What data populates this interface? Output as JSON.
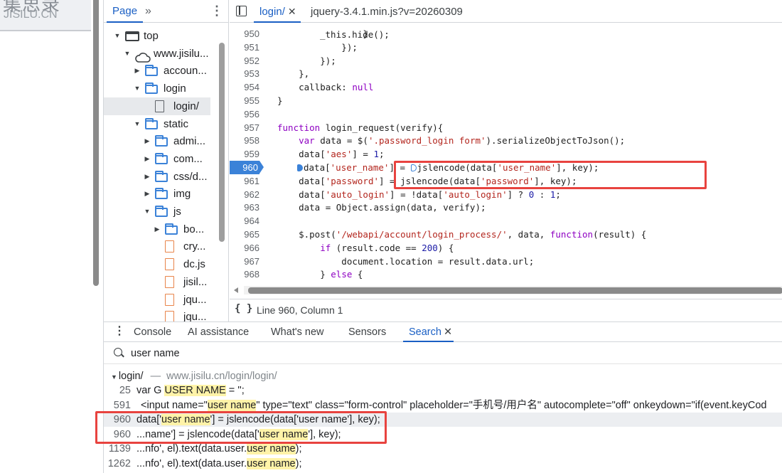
{
  "site": {
    "logo_cn": "集思录",
    "logo_en": "JISILU.CN"
  },
  "navigator": {
    "tab_label": "Page",
    "more_label": "»",
    "menu_label": "⋮",
    "items": [
      {
        "label": "top",
        "icon": "window-icon",
        "expand": "▼"
      },
      {
        "label": "www.jisilu...",
        "icon": "cloud-icon",
        "expand": "▼"
      },
      {
        "label": "accoun...",
        "icon": "folder-icon",
        "expand": "▶"
      },
      {
        "label": "login",
        "icon": "folder-icon",
        "expand": "▼"
      },
      {
        "label": "login/",
        "icon": "file-icon",
        "expand": ""
      },
      {
        "label": "static",
        "icon": "folder-icon",
        "expand": "▼"
      },
      {
        "label": "admi...",
        "icon": "folder-icon",
        "expand": "▶"
      },
      {
        "label": "com...",
        "icon": "folder-icon",
        "expand": "▶"
      },
      {
        "label": "css/d...",
        "icon": "folder-icon",
        "expand": "▶"
      },
      {
        "label": "img",
        "icon": "folder-icon",
        "expand": "▶"
      },
      {
        "label": "js",
        "icon": "folder-icon",
        "expand": "▼"
      },
      {
        "label": "bo...",
        "icon": "folder-icon",
        "expand": "▶"
      },
      {
        "label": "cry...",
        "icon": "js-file-icon",
        "expand": ""
      },
      {
        "label": "dc.js",
        "icon": "js-file-icon",
        "expand": ""
      },
      {
        "label": "jisil...",
        "icon": "js-file-icon",
        "expand": ""
      },
      {
        "label": "jqu...",
        "icon": "js-file-icon",
        "expand": ""
      },
      {
        "label": "jqu...",
        "icon": "js-file-icon",
        "expand": ""
      }
    ]
  },
  "editor": {
    "tabs": [
      {
        "label": "login/",
        "close": "✕"
      },
      {
        "label": "jquery-3.4.1.min.js?v=20260309"
      }
    ],
    "lines": [
      {
        "n": "950",
        "code": "                }"
      },
      {
        "n": "951",
        "code": "            });"
      },
      {
        "n": "952",
        "code": "        });"
      },
      {
        "n": "953",
        "code": "    },"
      },
      {
        "n": "954",
        "code": "    callback: null"
      },
      {
        "n": "955",
        "code": "}"
      },
      {
        "n": "956",
        "code": ""
      },
      {
        "n": "957",
        "code": "function login_request(verify){"
      },
      {
        "n": "958",
        "code": "    var data = $('.password_login form').serializeObjectToJson();"
      },
      {
        "n": "959",
        "code": "    data['aes'] = 1;"
      },
      {
        "n": "960",
        "code": "data['user_name'] = jslencode(data['user_name'], key);"
      },
      {
        "n": "961",
        "code": "    data['password'] = jslencode(data['password'], key);"
      },
      {
        "n": "962",
        "code": "    data['auto_login'] = !data['auto_login'] ? 0 : 1;"
      },
      {
        "n": "963",
        "code": "    data = Object.assign(data, verify);"
      },
      {
        "n": "964",
        "code": ""
      },
      {
        "n": "965",
        "code": "    $.post('/webapi/account/login_process/', data, function(result) {"
      },
      {
        "n": "966",
        "code": "        if (result.code == 200) {"
      },
      {
        "n": "967",
        "code": "            document.location = result.data.url;"
      },
      {
        "n": "968",
        "code": "        } else {"
      }
    ],
    "partial_top_line": "_this.hide();",
    "pretty_print_label": "{ }",
    "cursor_position": "Line 960, Column 1"
  },
  "drawer": {
    "menu_label": "⋮",
    "tabs": [
      "Console",
      "AI assistance",
      "What's new",
      "Sensors",
      "Search"
    ],
    "active_tab_close": "✕",
    "search_value": "user name",
    "result_file": {
      "name": "login/",
      "separator": "—",
      "path": "www.jisilu.cn/login/login/"
    },
    "results": [
      {
        "n": "25",
        "pre": "var G ",
        "match": "USER NAME",
        "post": " = '';"
      },
      {
        "n": "591",
        "pre": "<input name=\"",
        "match": "user name",
        "post": "\" type=\"text\" class=\"form-control\" placeholder=\"手机号/用户名\" autocomplete=\"off\" onkeydown=\"if(event.keyCod"
      },
      {
        "n": "960",
        "pre": "data['",
        "match": "user name",
        "post": "'] = jslencode(data['user name'], key);"
      },
      {
        "n": "960",
        "pre": "...name'] = jslencode(data['",
        "match": "user name",
        "post": "'], key);"
      },
      {
        "n": "1139",
        "pre": "...nfo', el).text(data.user.",
        "match": "user name",
        "post": ");"
      },
      {
        "n": "1262",
        "pre": "...nfo', el).text(data.user.",
        "match": "user name",
        "post": ");"
      }
    ]
  },
  "colors": {
    "accent": "#1a5fc4",
    "highlight_box": "#e8433f",
    "match_bg": "#fff3a8",
    "breakpoint": "#3b82d8"
  }
}
